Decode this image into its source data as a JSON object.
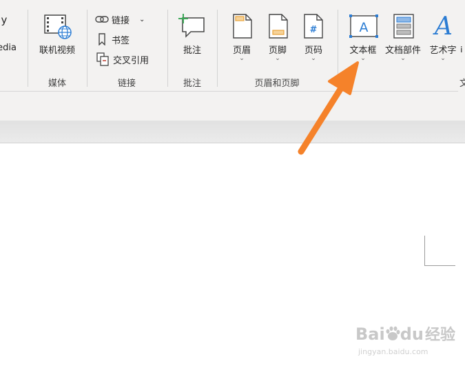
{
  "ribbon": {
    "partial_left": {
      "top_glyph": "y",
      "label": "edia"
    },
    "groups": {
      "media": {
        "label": "媒体",
        "online_video_label": "联机视频"
      },
      "links": {
        "label": "链接",
        "link_label": "链接",
        "bookmark_label": "书签",
        "cross_ref_label": "交叉引用"
      },
      "comments": {
        "label": "批注",
        "comment_label": "批注"
      },
      "header_footer": {
        "label": "页眉和页脚",
        "header_label": "页眉",
        "footer_label": "页脚",
        "page_number_label": "页码",
        "page_number_glyph": "#"
      },
      "text": {
        "label": "文",
        "textbox_label": "文本框",
        "textbox_glyph": "A",
        "quick_parts_label": "文档部件",
        "wordart_label": "艺术字",
        "wordart_glyph": "A"
      }
    },
    "chevron": "⌄"
  },
  "watermark": {
    "logo_text": "Bai",
    "logo_text2": "du",
    "logo_cn": "经验",
    "url": "jingyan.baidu.com"
  },
  "colors": {
    "arrow": "#f5822a",
    "ribbon_bg": "#f3f2f1",
    "accent_blue": "#2b7cd3",
    "accent_orange": "#e8a33b",
    "accent_green": "#3aa655"
  }
}
